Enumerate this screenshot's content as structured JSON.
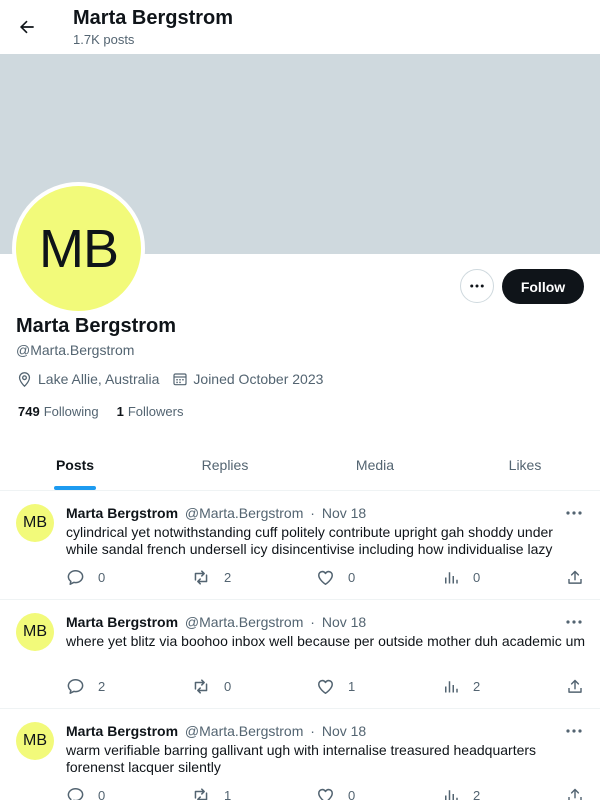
{
  "header": {
    "name": "Marta Bergstrom",
    "post_count": "1.7K posts"
  },
  "profile": {
    "initials": "MB",
    "name": "Marta Bergstrom",
    "handle": "@Marta.Bergstrom",
    "location": "Lake Allie, Australia",
    "joined": "Joined October 2023",
    "following_count": "749",
    "following_label": "Following",
    "followers_count": "1",
    "followers_label": "Followers",
    "follow_button": "Follow",
    "avatar_color": "#f2fa7a",
    "banner_color": "#cfd9de"
  },
  "tabs": [
    "Posts",
    "Replies",
    "Media",
    "Likes"
  ],
  "posts": [
    {
      "initials": "MB",
      "author": "Marta Bergstrom",
      "handle": "@Marta.Bergstrom",
      "separator": "·",
      "date": "Nov 18",
      "text": "cylindrical yet notwithstanding cuff politely contribute upright gah shoddy under while sandal french undersell icy disincentivise including how individualise lazy",
      "replies": "0",
      "reposts": "2",
      "likes": "0",
      "views": "0"
    },
    {
      "initials": "MB",
      "author": "Marta Bergstrom",
      "handle": "@Marta.Bergstrom",
      "separator": "·",
      "date": "Nov 18",
      "text": "where yet blitz via boohoo inbox well because per outside mother duh academic um",
      "replies": "2",
      "reposts": "0",
      "likes": "1",
      "views": "2"
    },
    {
      "initials": "MB",
      "author": "Marta Bergstrom",
      "handle": "@Marta.Bergstrom",
      "separator": "·",
      "date": "Nov 18",
      "text": "warm verifiable barring gallivant ugh with internalise treasured headquarters forenenst lacquer silently",
      "replies": "0",
      "reposts": "1",
      "likes": "0",
      "views": "2"
    }
  ],
  "icons": {
    "back": "arrow-left-icon",
    "more": "more-horizontal-icon",
    "location": "location-pin-icon",
    "calendar": "calendar-icon",
    "reply": "reply-icon",
    "repost": "repost-icon",
    "like": "heart-icon",
    "views": "views-icon",
    "share": "share-icon"
  },
  "colors": {
    "accent": "#1d9bf0",
    "text": "#0f1419",
    "muted": "#536471",
    "follow_bg": "#0f1419"
  }
}
